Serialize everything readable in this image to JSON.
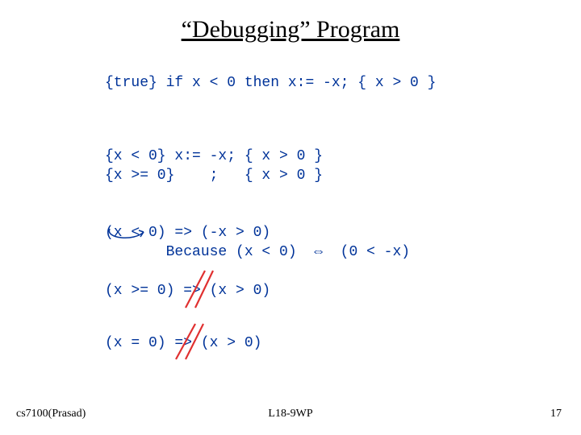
{
  "title": "“Debugging” Program",
  "code": {
    "line1": "{true} if x < 0 then x:= -x; { x > 0 }",
    "line2a": "{x < 0} x:= -x; { x > 0 }",
    "line2b": "{x >= 0}    ;   { x > 0 }",
    "line3a": "(x < 0) => (-x > 0)",
    "line3b_prefix": "       Because (x < 0)  ",
    "line3b_sym": "⇔",
    "line3b_suffix": "  (0 < -x)",
    "line4": "(x >= 0) => (x > 0)",
    "line5": "(x = 0) => (x > 0)"
  },
  "footer": {
    "left": "cs7100(Prasad)",
    "center": "L18-9WP",
    "right": "17"
  }
}
